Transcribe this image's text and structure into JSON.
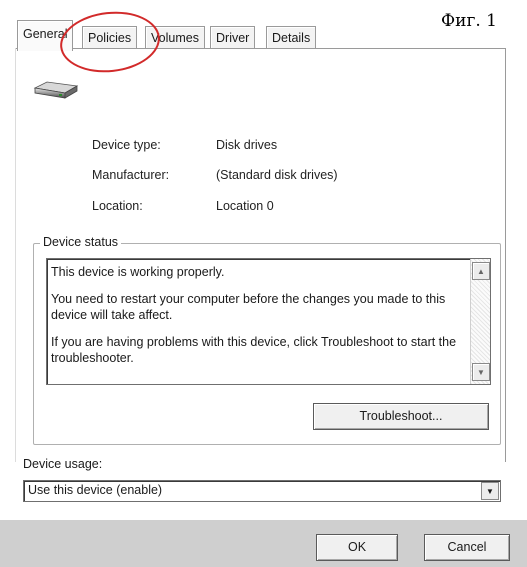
{
  "figure_label": "Фиг. 1",
  "tabs": [
    {
      "label": "General",
      "active": true
    },
    {
      "label": "Policies",
      "active": false
    },
    {
      "label": "Volumes",
      "active": false
    },
    {
      "label": "Driver",
      "active": false
    },
    {
      "label": "Details",
      "active": false
    }
  ],
  "device_icon": "hard-drive-icon",
  "properties": [
    {
      "label": "Device type:",
      "value": "Disk drives"
    },
    {
      "label": "Manufacturer:",
      "value": "(Standard disk drives)"
    },
    {
      "label": "Location:",
      "value": "Location 0"
    }
  ],
  "device_status": {
    "title": "Device status",
    "paragraphs": [
      "This device is working properly.",
      "You need to restart your computer before the changes you made to this device will take affect.",
      "If you are having problems with this device, click Troubleshoot to start the troubleshooter."
    ],
    "troubleshoot_label": "Troubleshoot..."
  },
  "device_usage": {
    "label": "Device usage:",
    "value": "Use this device (enable)"
  },
  "buttons": {
    "ok": "OK",
    "cancel": "Cancel"
  },
  "annotation": {
    "highlight": "red-circle-around-policies-tab",
    "color": "#d22a2a"
  }
}
